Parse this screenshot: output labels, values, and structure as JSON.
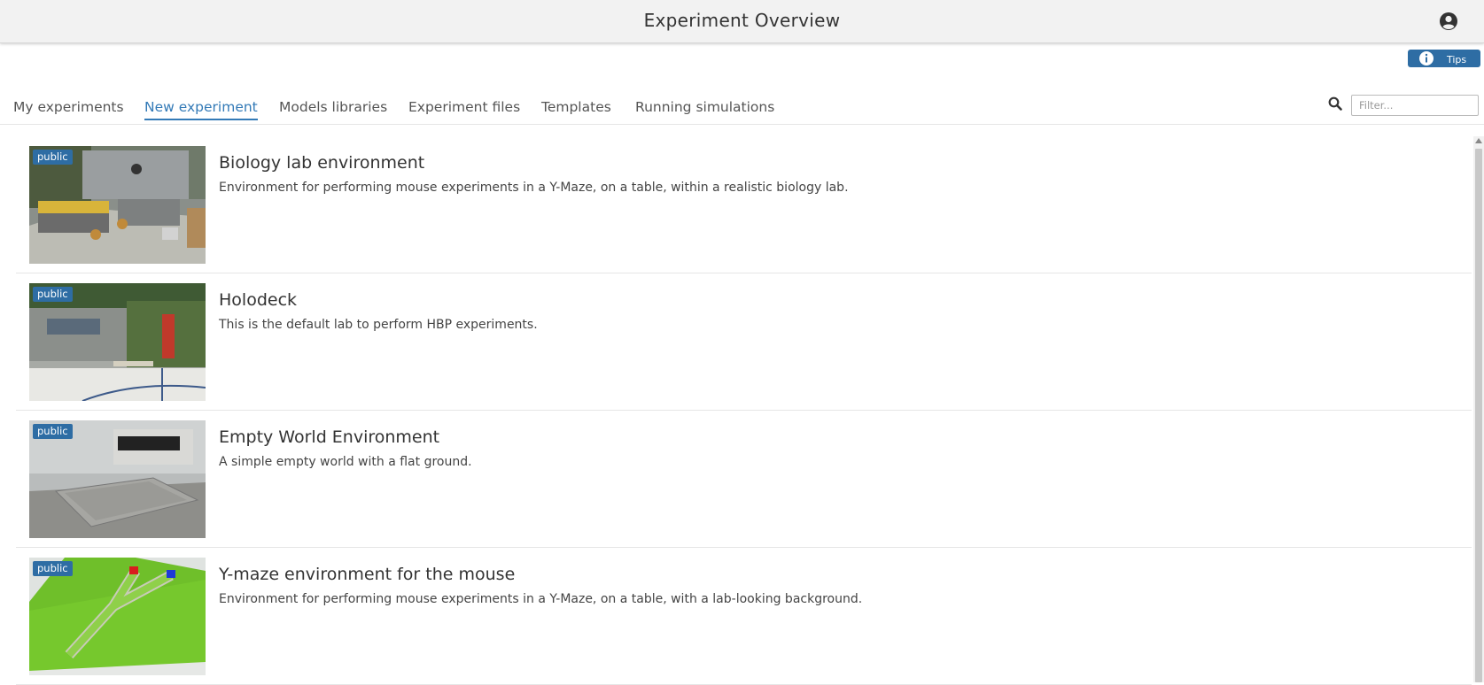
{
  "header": {
    "title": "Experiment Overview",
    "user_icon": "user-circle-icon"
  },
  "tips": {
    "label": "Tips",
    "icon": "info-icon"
  },
  "tabs": [
    {
      "label": "My experiments",
      "active": false
    },
    {
      "label": "New experiment",
      "active": true
    },
    {
      "label": "Models libraries",
      "active": false
    },
    {
      "label": "Experiment files",
      "active": false
    },
    {
      "label": "Templates",
      "active": false
    },
    {
      "label": "Running simulations",
      "active": false
    }
  ],
  "search": {
    "icon": "search-icon",
    "placeholder": "Filter...",
    "value": ""
  },
  "experiments": [
    {
      "badge": "public",
      "title": "Biology lab environment",
      "description": "Environment for performing mouse experiments in a Y-Maze, on a table, within a realistic biology lab."
    },
    {
      "badge": "public",
      "title": "Holodeck",
      "description": "This is the default lab to perform HBP experiments."
    },
    {
      "badge": "public",
      "title": "Empty World Environment",
      "description": "A simple empty world with a flat ground."
    },
    {
      "badge": "public",
      "title": "Y-maze environment for the mouse",
      "description": "Environment for performing mouse experiments in a Y-Maze, on a table, with a lab-looking background."
    }
  ],
  "colors": {
    "accent": "#337ab7",
    "badge": "#2e6da4",
    "topbar": "#f2f2f2"
  }
}
